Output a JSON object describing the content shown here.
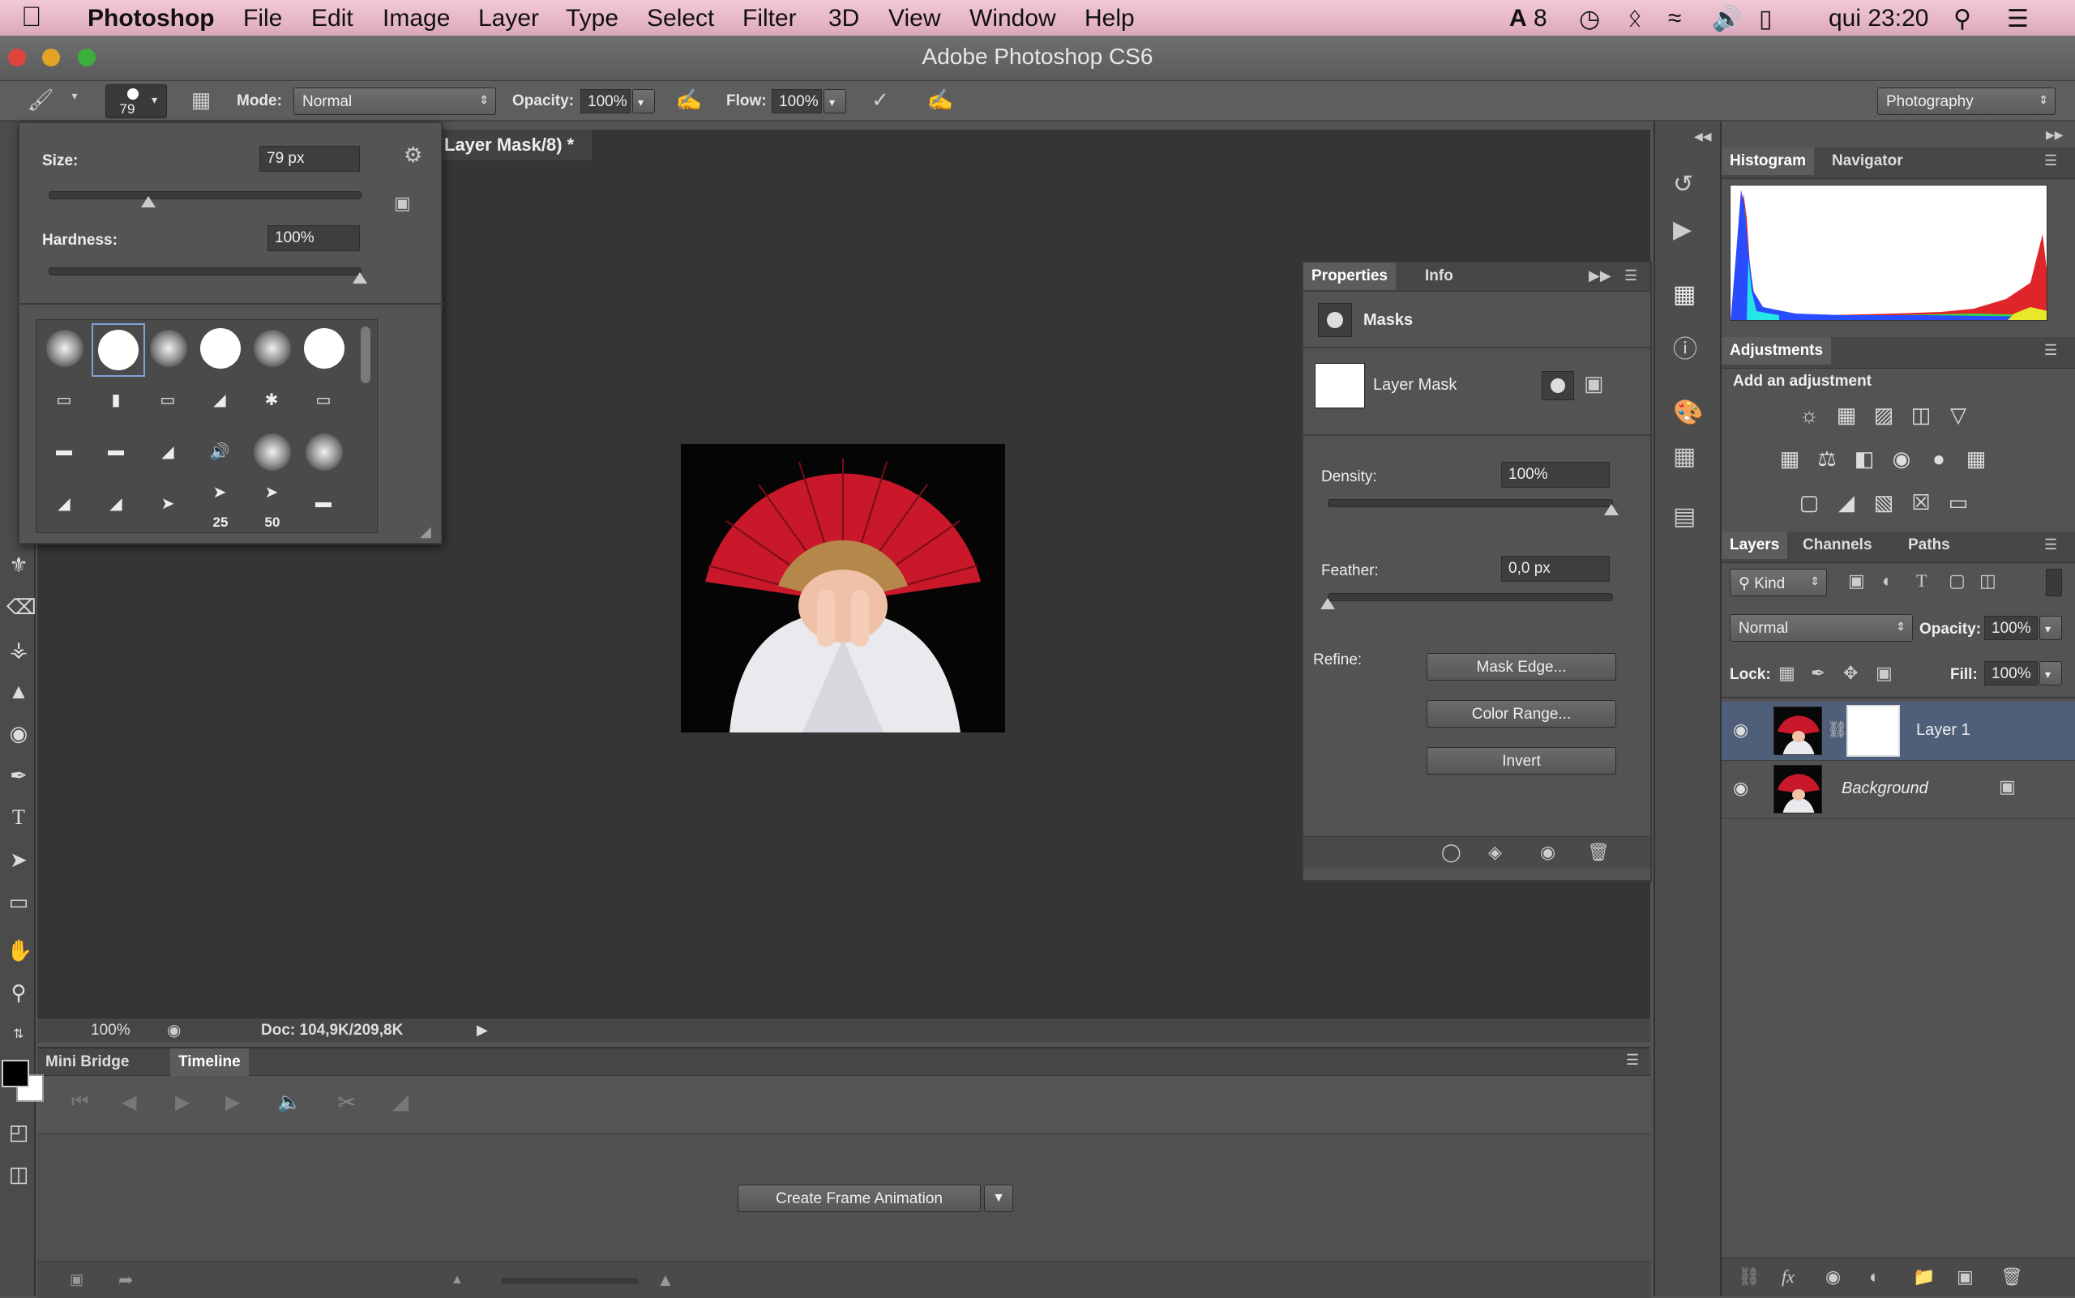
{
  "menubar": {
    "app": "Photoshop",
    "items": [
      "File",
      "Edit",
      "Image",
      "Layer",
      "Type",
      "Select",
      "Filter",
      "3D",
      "View",
      "Window",
      "Help"
    ],
    "status": {
      "badge": "8",
      "clock": "qui 23:20"
    }
  },
  "window": {
    "title": "Adobe Photoshop CS6"
  },
  "options": {
    "brush_size": "79",
    "mode_label": "Mode:",
    "mode_value": "Normal",
    "opacity_label": "Opacity:",
    "opacity_value": "100%",
    "flow_label": "Flow:",
    "flow_value": "100%",
    "workspace": "Photography"
  },
  "brush_picker": {
    "size_label": "Size:",
    "size_value": "79 px",
    "hardness_label": "Hardness:",
    "hardness_value": "100%",
    "size_level": 0.32,
    "hardness_level": 1.0,
    "tip_numbers": [
      "25",
      "50"
    ]
  },
  "document": {
    "tab_title": "Layer Mask/8) *",
    "zoom": "100%",
    "doc_info": "Doc: 104,9K/209,8K"
  },
  "bottom_panel": {
    "tabs": [
      "Mini Bridge",
      "Timeline"
    ],
    "active_tab": "Timeline",
    "create_button": "Create Frame Animation"
  },
  "properties": {
    "tabs": [
      "Properties",
      "Info"
    ],
    "section": "Masks",
    "mask_name": "Layer Mask",
    "density_label": "Density:",
    "density_value": "100%",
    "feather_label": "Feather:",
    "feather_value": "0,0 px",
    "refine_label": "Refine:",
    "buttons": [
      "Mask Edge...",
      "Color Range...",
      "Invert"
    ]
  },
  "histogram": {
    "tabs": [
      "Histogram",
      "Navigator"
    ]
  },
  "adjustments": {
    "title": "Adjustments",
    "subtitle": "Add an adjustment"
  },
  "layers_panel": {
    "tabs": [
      "Layers",
      "Channels",
      "Paths"
    ],
    "filter": "Kind",
    "blend_mode": "Normal",
    "opacity_label": "Opacity:",
    "opacity_value": "100%",
    "lock_label": "Lock:",
    "fill_label": "Fill:",
    "fill_value": "100%",
    "layers": [
      {
        "name": "Layer 1",
        "selected": true
      },
      {
        "name": "Background",
        "selected": false
      }
    ]
  },
  "colors": {
    "accent_selected": "#4f5f7a",
    "fan_red": "#c8182a",
    "histogram_red": "#e0252a",
    "histogram_blue": "#2a4cff",
    "histogram_green": "#2ce04a"
  }
}
